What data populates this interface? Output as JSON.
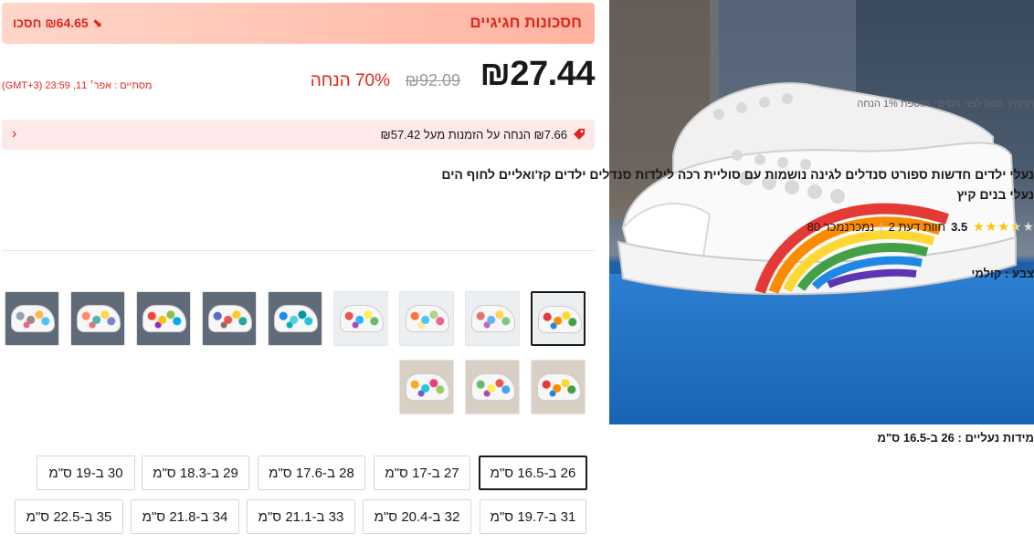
{
  "banner": {
    "title": "חסכונות חגיגיים",
    "save_text": "₪64.65 חסכו"
  },
  "price": {
    "current": "₪27.44",
    "original": "₪92.09",
    "discount": "70% הנחה",
    "timer": "מסתיים : אפר׳ 11, 23:59 (GMT+3)",
    "tax_note": "המחיר מוצג לפני מסים ; תוספת 1% הנחה"
  },
  "coupon": {
    "text": "₪7.66 הנחה על הזמנות מעל ₪57.42"
  },
  "product": {
    "title": "נעלי ילדים חדשות ספורט סנדלים לגינה נושמות עם סוליית רכה לילדות סנדלים ילדים קז'ואליים לחוף הים נעלי בנים קיץ"
  },
  "rating": {
    "value": "3.5",
    "stars": 3.5,
    "reviews": "2 חוות דעת",
    "sold": "80 נמכרנמכר"
  },
  "color": {
    "label": "צבע : קולמי",
    "thumb_count": 12,
    "selected_index": 0
  },
  "sizes": {
    "label": "מידות נעליים : 26 ב-16.5 ס\"מ",
    "options": [
      "26 ב-16.5 ס\"מ",
      "27 ב-17 ס\"מ",
      "28 ב-17.6 ס\"מ",
      "29 ב-18.3 ס\"מ",
      "30 ב-19 ס\"מ",
      "31 ב-19.7 ס\"מ",
      "32 ב-20.4 ס\"מ",
      "33 ב-21.1 ס\"מ",
      "34 ב-21.8 ס\"מ",
      "35 ב-22.5 ס\"מ"
    ],
    "selected_index": 0
  },
  "colors": {
    "accent": "#e1251b",
    "banner_start": "#ffd6c9",
    "banner_end": "#ffb3a0",
    "coupon_bg": "#fde8ea",
    "star": "#ffc400"
  },
  "icons": {
    "banner": "down-arrow-icon",
    "coupon": "tag-icon",
    "coupon_more": "chevron-right-icon",
    "star": "star-icon"
  }
}
